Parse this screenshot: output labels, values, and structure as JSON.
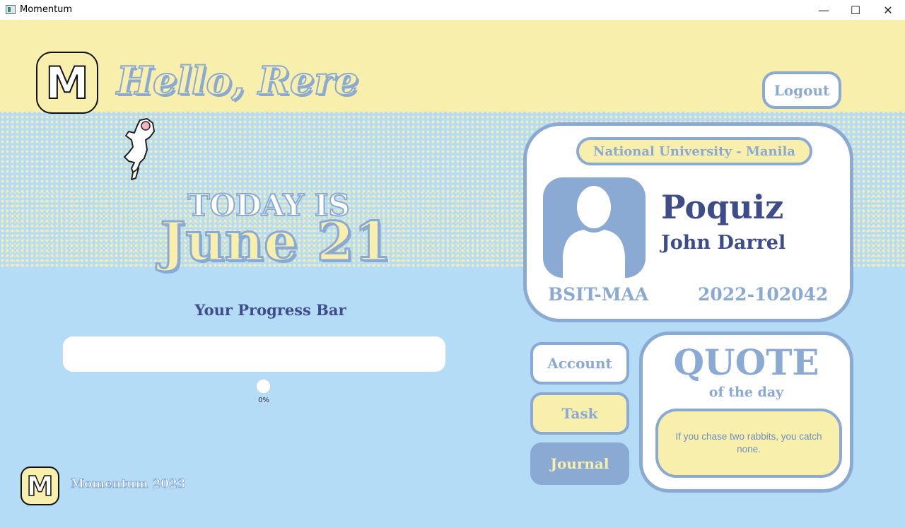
{
  "window": {
    "title": "Momentum",
    "controls": {
      "minimize": "—",
      "maximize": "☐",
      "close": "✕"
    }
  },
  "header": {
    "logo_glyph": "M",
    "greeting": "Hello, Rere",
    "logout_label": "Logout"
  },
  "today": {
    "prefix": "TODAY IS",
    "date": "June 21"
  },
  "progress": {
    "label": "Your Progress Bar",
    "value_percent": 0,
    "value_text": "0%"
  },
  "profile": {
    "university": "National University - Manila",
    "surname": "Poquiz",
    "first_name": "John Darrel",
    "section": "BSIT-MAA",
    "student_id": "2022-102042"
  },
  "nav": {
    "account": "Account",
    "task": "Task",
    "journal": "Journal"
  },
  "quote": {
    "title": "QUOTE",
    "subtitle": "of the day",
    "text": "If you chase two rabbits, you catch none."
  },
  "footer": {
    "logo_glyph": "M",
    "text": "Momentum 2023"
  },
  "colors": {
    "sky": "#b5dcf6",
    "butter": "#f8efad",
    "accent_blue": "#8aaad4",
    "navy": "#3f4c8a"
  }
}
